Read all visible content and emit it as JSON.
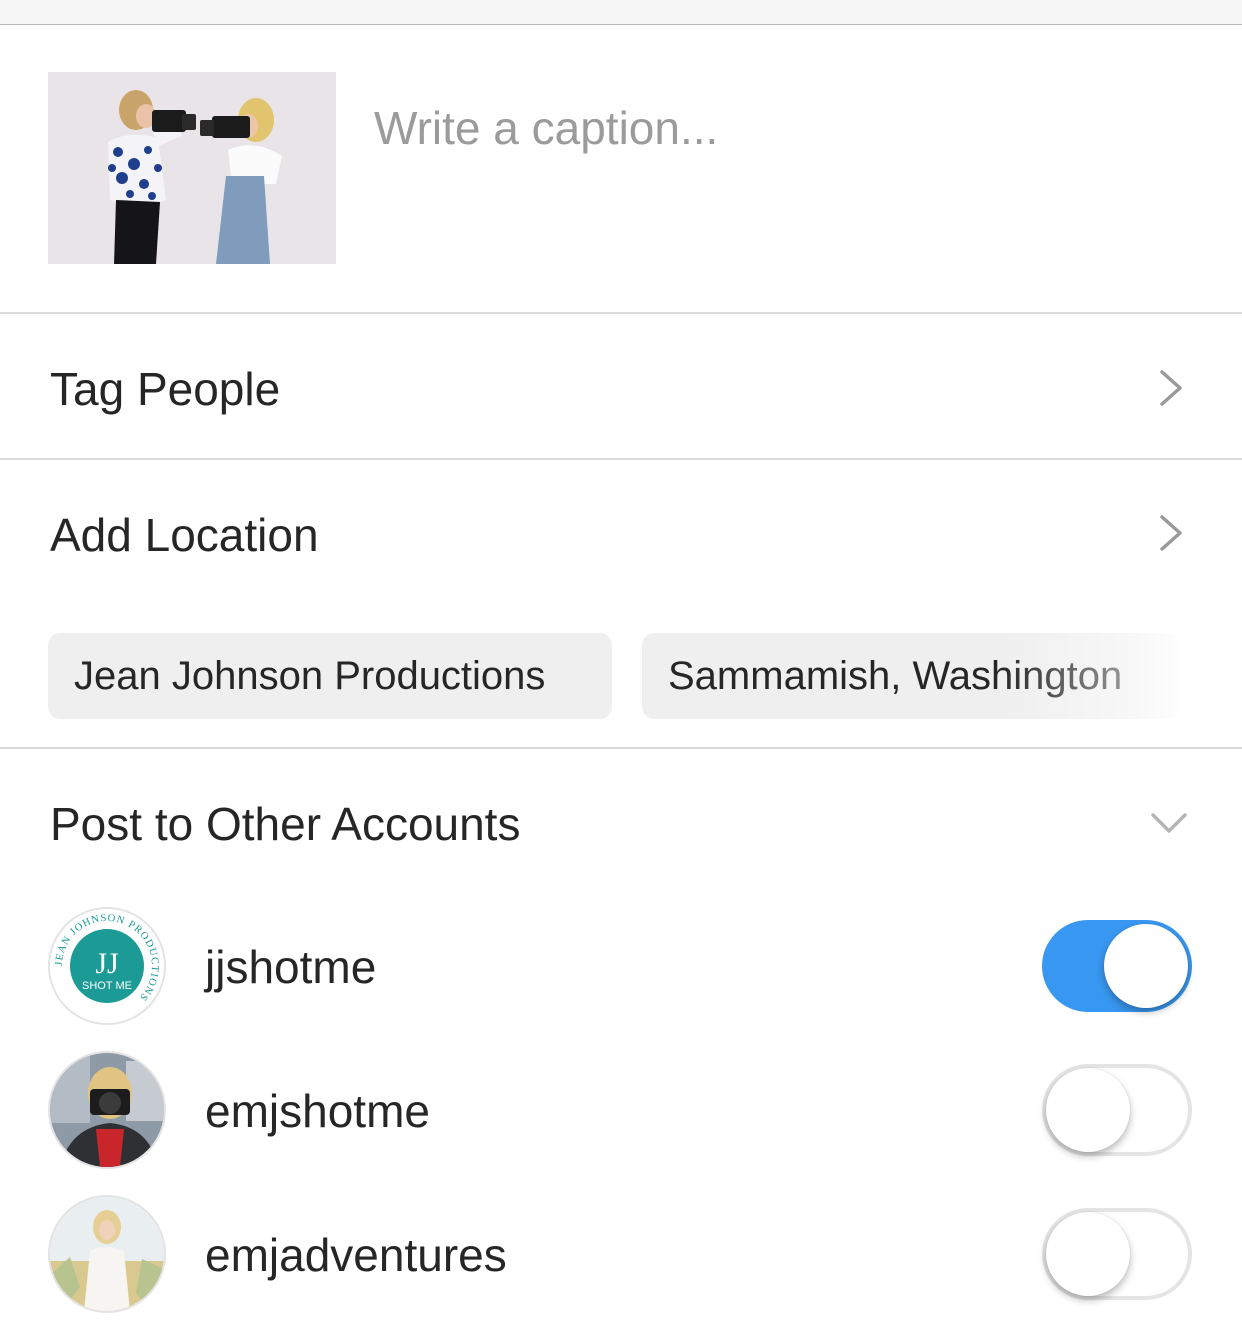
{
  "caption": {
    "placeholder": "Write a caption..."
  },
  "rows": {
    "tag_people": "Tag People",
    "add_location": "Add Location"
  },
  "location_suggestions": [
    "Jean Johnson Productions",
    "Sammamish, Washington"
  ],
  "post_other": {
    "title": "Post to Other Accounts",
    "accounts": [
      {
        "username": "jjshotme",
        "enabled": true,
        "logo_initials": "JJ",
        "logo_subtext": "SHOT ME",
        "logo_ring_text": "JEAN JOHNSON PRODUCTIONS"
      },
      {
        "username": "emjshotme",
        "enabled": false
      },
      {
        "username": "emjadventures",
        "enabled": false
      }
    ]
  },
  "colors": {
    "toggle_on": "#3897f0",
    "logo_teal": "#1b9a96",
    "divider": "#dbdbdb"
  },
  "icons": {
    "tag_people_chevron": "chevron-right-icon",
    "add_location_chevron": "chevron-right-icon",
    "post_other_chevron": "chevron-down-icon"
  }
}
